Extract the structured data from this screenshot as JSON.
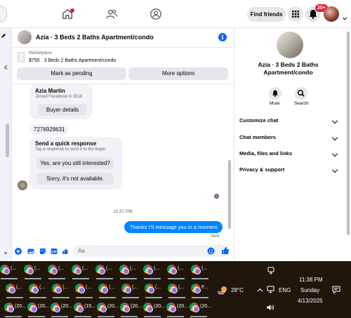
{
  "topbar": {
    "find_friends": "Find friends",
    "notif_badge": "20+"
  },
  "chat": {
    "title": "Azia · 3 Beds 2 Baths Apartment/condo",
    "marketplace_label": "Marketplace",
    "marketplace_item": "$750 · 3 Beds 2 Baths Apartment/condo",
    "mark_pending": "Mark as pending",
    "more_options": "More options",
    "buyer_name": "Azia Martin",
    "buyer_joined": "Joined Facebook in 2018",
    "buyer_details": "Buyer details",
    "phone": "7276928631",
    "quick_title": "Send a quick response",
    "quick_sub": "Tap a response to send it to the buyer.",
    "quick_1": "Yes, are you still interested?",
    "quick_2": "Sorry, it's not available.",
    "timestamp": "11:37 PM",
    "my_message": "Thanks i\"ll message you in a moment",
    "sent_status": "Sent",
    "composer_placeholder": "Aa"
  },
  "rightpanel": {
    "title": "Azia · 3 Beds 2 Baths Apartment/condo",
    "mute": "Mute",
    "search": "Search",
    "rows": [
      "Customize chat",
      "Chat members",
      "Media, files and links",
      "Privacy & support"
    ]
  },
  "taskbar": {
    "row1": [
      "(...",
      "(...",
      "(...",
      "(...",
      "(...",
      "(...",
      "(...",
      "(...",
      "(..."
    ],
    "row2": [
      "(...",
      "(...",
      "(...",
      "(...",
      "(...",
      "(...",
      "(...",
      "(...",
      "F..."
    ],
    "row3": [
      "(20...",
      "(20...",
      "(20...",
      "(15...",
      "(20...",
      "(20...",
      "(20...",
      "(20...",
      "(20..."
    ],
    "temperature": "28°C",
    "language": "ENG",
    "time": "11:38 PM",
    "day": "Sunday",
    "date": "4/13/2025"
  },
  "colors": {
    "accent": "#0866ff",
    "bubble": "#0084ff",
    "badge": "#e41e3f",
    "taskbar": "#20160b"
  }
}
